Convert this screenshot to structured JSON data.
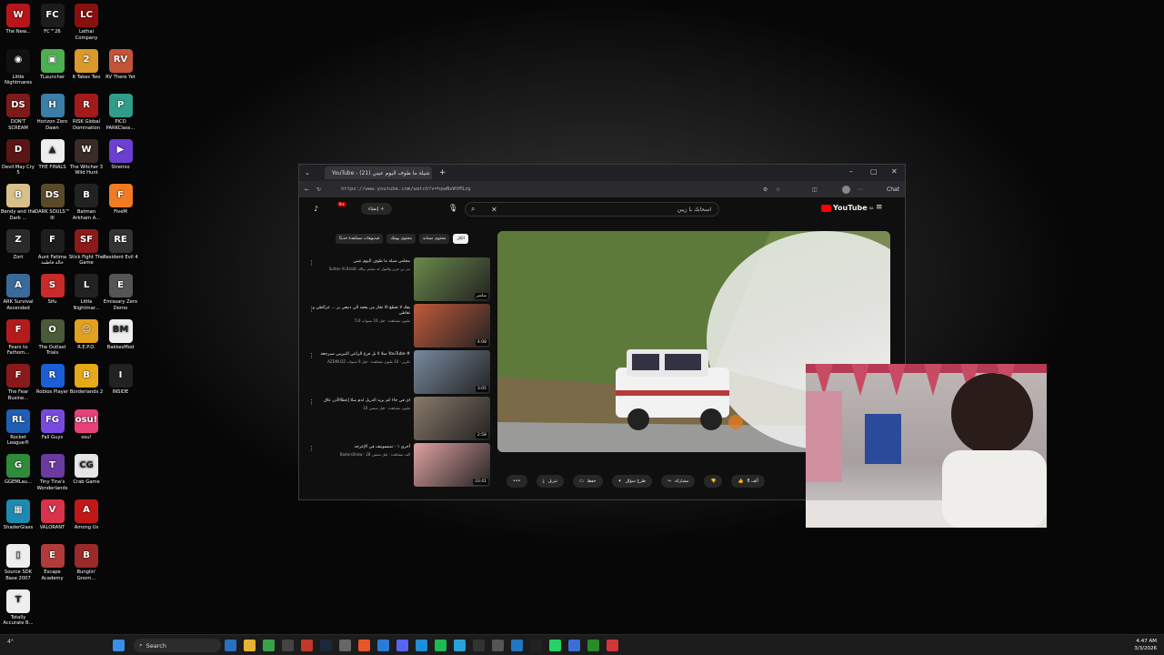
{
  "desktop_icons": [
    {
      "label": "The New...",
      "color": "#b8141b",
      "glyph": "W",
      "col": 0,
      "row": 0
    },
    {
      "label": "FC™26",
      "color": "#1c1c1c",
      "glyph": "FC",
      "col": 1,
      "row": 0
    },
    {
      "label": "Lethal Company",
      "color": "#8a1010",
      "glyph": "LC",
      "col": 2,
      "row": 0
    },
    {
      "label": "Little Nightmares",
      "color": "#111",
      "glyph": "◉",
      "col": 0,
      "row": 1
    },
    {
      "label": "TLauncher",
      "color": "#4caf50",
      "glyph": "▣",
      "col": 1,
      "row": 1
    },
    {
      "label": "It Takes Two",
      "color": "#d99a2b",
      "glyph": "2",
      "col": 2,
      "row": 1
    },
    {
      "label": "RV There Yet",
      "color": "#c2543a",
      "glyph": "RV",
      "col": 3,
      "row": 1
    },
    {
      "label": "DON'T SCREAM",
      "color": "#7d1a1a",
      "glyph": "DS",
      "col": 0,
      "row": 2
    },
    {
      "label": "Horizon Zero Dawn",
      "color": "#3b7fa8",
      "glyph": "H",
      "col": 1,
      "row": 2
    },
    {
      "label": "RISK Global Domination",
      "color": "#a21b1b",
      "glyph": "R",
      "col": 2,
      "row": 2
    },
    {
      "label": "PICO PARKClass...",
      "color": "#2f9d8a",
      "glyph": "P",
      "col": 3,
      "row": 2
    },
    {
      "label": "Devil May Cry 5",
      "color": "#5a1515",
      "glyph": "D",
      "col": 0,
      "row": 3
    },
    {
      "label": "THE FINALS",
      "color": "#eee",
      "glyph": "▲",
      "col": 1,
      "row": 3
    },
    {
      "label": "The Witcher 3 Wild Hunt",
      "color": "#3a2b24",
      "glyph": "W",
      "col": 2,
      "row": 3
    },
    {
      "label": "Stremio",
      "color": "#6b3fd1",
      "glyph": "▶",
      "col": 3,
      "row": 3
    },
    {
      "label": "Bendy and the Dark ...",
      "color": "#d8c08a",
      "glyph": "B",
      "col": 0,
      "row": 4
    },
    {
      "label": "DARK SOULS™ III",
      "color": "#5a4a2a",
      "glyph": "DS",
      "col": 1,
      "row": 4
    },
    {
      "label": "Batman Arkham A...",
      "color": "#222",
      "glyph": "B",
      "col": 2,
      "row": 4
    },
    {
      "label": "FiveM",
      "color": "#f07b22",
      "glyph": "F",
      "col": 3,
      "row": 4
    },
    {
      "label": "Zort",
      "color": "#2a2a2a",
      "glyph": "Z",
      "col": 0,
      "row": 5
    },
    {
      "label": "Aunt Fatima خالة فاطمة",
      "color": "#1e1e1e",
      "glyph": "F",
      "col": 1,
      "row": 5
    },
    {
      "label": "Stick Fight The Game",
      "color": "#8b1a1a",
      "glyph": "SF",
      "col": 2,
      "row": 5
    },
    {
      "label": "Resident Evil 4",
      "color": "#333",
      "glyph": "RE",
      "col": 3,
      "row": 5
    },
    {
      "label": "ARK Survival Ascended",
      "color": "#3a6a9a",
      "glyph": "A",
      "col": 0,
      "row": 6
    },
    {
      "label": "Sifu",
      "color": "#c92a2a",
      "glyph": "S",
      "col": 1,
      "row": 6
    },
    {
      "label": "Little Nightmar...",
      "color": "#222",
      "glyph": "L",
      "col": 2,
      "row": 6
    },
    {
      "label": "Emissary Zero Demo",
      "color": "#555",
      "glyph": "E",
      "col": 3,
      "row": 6
    },
    {
      "label": "Fears to Fathom...",
      "color": "#b41c1c",
      "glyph": "F",
      "col": 0,
      "row": 7
    },
    {
      "label": "The Outlast Trials",
      "color": "#4a5a3a",
      "glyph": "O",
      "col": 1,
      "row": 7
    },
    {
      "label": "R.E.P.O.",
      "color": "#e0a020",
      "glyph": "☺",
      "col": 2,
      "row": 7
    },
    {
      "label": "BakkesMod",
      "color": "#eee",
      "glyph": "BM",
      "col": 3,
      "row": 7
    },
    {
      "label": "The Fear Busine...",
      "color": "#8a1a1a",
      "glyph": "F",
      "col": 0,
      "row": 8
    },
    {
      "label": "Roblox Player",
      "color": "#1a5fd6",
      "glyph": "R",
      "col": 1,
      "row": 8
    },
    {
      "label": "Borderlands 2",
      "color": "#e6a91a",
      "glyph": "B",
      "col": 2,
      "row": 8
    },
    {
      "label": "INSIDE",
      "color": "#222",
      "glyph": "I",
      "col": 3,
      "row": 8
    },
    {
      "label": "Rocket League®",
      "color": "#1e5fb4",
      "glyph": "RL",
      "col": 0,
      "row": 9
    },
    {
      "label": "Fall Guys",
      "color": "#7a4ae0",
      "glyph": "FG",
      "col": 1,
      "row": 9
    },
    {
      "label": "osu!",
      "color": "#e8407a",
      "glyph": "osu!",
      "col": 2,
      "row": 9
    },
    {
      "label": "GGEMLau...",
      "color": "#2e8b3a",
      "glyph": "G",
      "col": 0,
      "row": 10
    },
    {
      "label": "Tiny Tina's Wonderlands",
      "color": "#6a3aa0",
      "glyph": "T",
      "col": 1,
      "row": 10
    },
    {
      "label": "Crab Game",
      "color": "#e6e6e6",
      "glyph": "CG",
      "col": 2,
      "row": 10
    },
    {
      "label": "ShaderGlass",
      "color": "#1f8ab0",
      "glyph": "▦",
      "col": 0,
      "row": 11
    },
    {
      "label": "VALORANT",
      "color": "#d8334a",
      "glyph": "V",
      "col": 1,
      "row": 11
    },
    {
      "label": "Among Us",
      "color": "#c01818",
      "glyph": "A",
      "col": 2,
      "row": 11
    },
    {
      "label": "Source SDK Base 2007",
      "color": "#eee",
      "glyph": "▯",
      "col": 0,
      "row": 12
    },
    {
      "label": "Escape Academy",
      "color": "#b13a3a",
      "glyph": "E",
      "col": 1,
      "row": 12
    },
    {
      "label": "Bunglin' Gnom...",
      "color": "#9a2a2a",
      "glyph": "B",
      "col": 2,
      "row": 12
    },
    {
      "label": "Totally Accurate B...",
      "color": "#eee",
      "glyph": "T",
      "col": 0,
      "row": 13
    }
  ],
  "browser": {
    "tab_title": "YouTube - (21) شيلة ما طوف اليوم عيني",
    "new_tab": "+",
    "url": "https://www.youtube.com/watch?v=hpwNvWtM1zg",
    "chat": "Chat",
    "minimize": "–",
    "maximize": "▢",
    "close": "✕"
  },
  "youtube": {
    "logo": "YouTube",
    "logo_sup": "SA",
    "search_value": "اسحابك يا زيبن",
    "create": "إنشاء",
    "notif_count": "9+",
    "chips": [
      "الكل",
      "محتوى مشابه",
      "محتوى يهمك",
      "فيديوهات مشاهدة حديثًا"
    ],
    "recommendations": [
      {
        "title": "مجلس شيلة ما طوف اليوم عيني",
        "meta": "Sultan Al Braiki بدر بن عزيز والقول له مشعر بيالك",
        "duration": "مباشر",
        "color": "#6a8a4a"
      },
      {
        "title": "يفك لا تقطع الا تخاز من يعجه الي دنيعي بر ... عرالطي و تفاطي",
        "meta": "5.6 مليون مشاهدة · قبل 10 سنوات",
        "duration": "4:08",
        "color": "#c25a3a"
      },
      {
        "title": "سلا لا بل فرغ الراعي التيرييي سيرجعة YouTube #",
        "meta": "AZDIN DZ تكرير · 10 مليون مشاهدة · قبل 9 سنوات",
        "duration": "3:05",
        "color": "#7a8aa0"
      },
      {
        "title": "اي في جاء كم بريد الدريل لدم سلا إعطاالأدن عاق",
        "meta": "10 مليون مشاهدة · قبل سنتين",
        "duration": "2:58",
        "color": "#8a7a6a"
      },
      {
        "title": "أخرى ١ - تمنسونيف في الإعرجد",
        "meta": "BadersShow · 28 ألف مشاهدة · قبل سنتين",
        "duration": "33:41",
        "color": "#e0a0a0"
      }
    ],
    "actions": {
      "like": "8 ألف",
      "share": "مشاركة",
      "ask": "طرح سؤال",
      "save": "حفظ",
      "download": "تنزيل",
      "more": "•••"
    }
  },
  "taskbar": {
    "weather": "4°",
    "search_placeholder": "Search",
    "time": "4:47 AM",
    "date": "3/3/2026"
  }
}
